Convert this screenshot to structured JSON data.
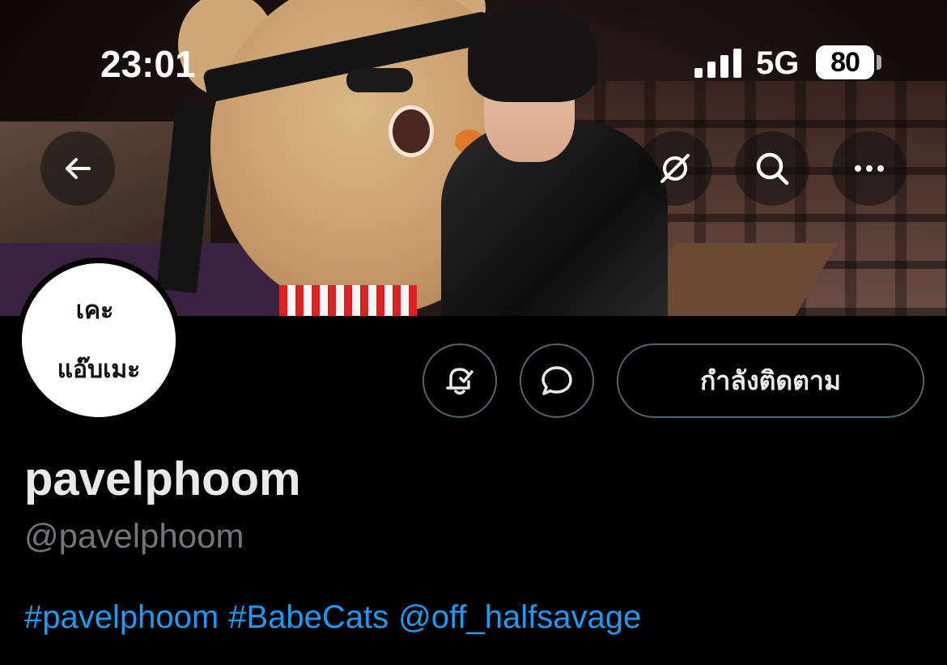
{
  "status_bar": {
    "time": "23:01",
    "network": "5G",
    "battery": "80",
    "signal_bars": 4
  },
  "header_actions": {
    "back_icon": "arrow-left-icon",
    "grok_icon": "grok-slash-icon",
    "search_icon": "search-icon",
    "more_icon": "more-horizontal-icon"
  },
  "avatar": {
    "line1": "เคะ",
    "line2": "แอ๊บเมะ"
  },
  "actions": {
    "notify_icon": "bell-check-icon",
    "message_icon": "message-bubble-icon",
    "following_label": "กำลังติดตาม"
  },
  "profile": {
    "display_name": "pavelphoom",
    "handle": "@pavelphoom",
    "bio": {
      "tag1": "#pavelphoom",
      "tag2": "#BabeCats",
      "mention": "@off_halfsavage"
    }
  },
  "colors": {
    "background": "#000000",
    "text": "#e7e9ea",
    "muted": "#71767b",
    "link": "#1d9bf0",
    "border": "#536471"
  }
}
